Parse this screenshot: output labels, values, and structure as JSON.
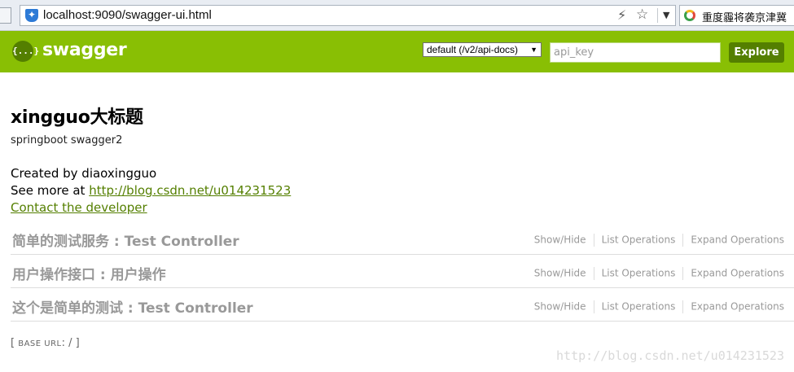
{
  "browser": {
    "url": "localhost:9090/swagger-ui.html",
    "search_text": "重度霾将袭京津冀"
  },
  "header": {
    "logo_glyph": "{...}",
    "brand": "swagger",
    "spec_select": "default (/v2/api-docs)",
    "api_key_placeholder": "api_key",
    "explore_label": "Explore",
    "brand_color": "#89bf04",
    "accent_dark": "#547f00"
  },
  "info": {
    "title": "xingguo大标题",
    "description": "springboot swagger2",
    "created_by": "Created by diaoxingguo",
    "see_more_prefix": "See more at ",
    "see_more_link": "http://blog.csdn.net/u014231523",
    "contact_label": "Contact the developer"
  },
  "resources": [
    {
      "name": "简单的测试服务 : Test Controller",
      "show_hide": "Show/Hide",
      "list_ops": "List Operations",
      "expand_ops": "Expand Operations"
    },
    {
      "name": "用户操作接口 : 用户操作",
      "show_hide": "Show/Hide",
      "list_ops": "List Operations",
      "expand_ops": "Expand Operations"
    },
    {
      "name": "这个是简单的测试 : Test Controller",
      "show_hide": "Show/Hide",
      "list_ops": "List Operations",
      "expand_ops": "Expand Operations"
    }
  ],
  "footer": {
    "open_bracket": "[",
    "base_url_label": "BASE URL",
    "colon": ":",
    "base_url_value": "/",
    "close_bracket": "]"
  },
  "watermark": "http://blog.csdn.net/u014231523"
}
